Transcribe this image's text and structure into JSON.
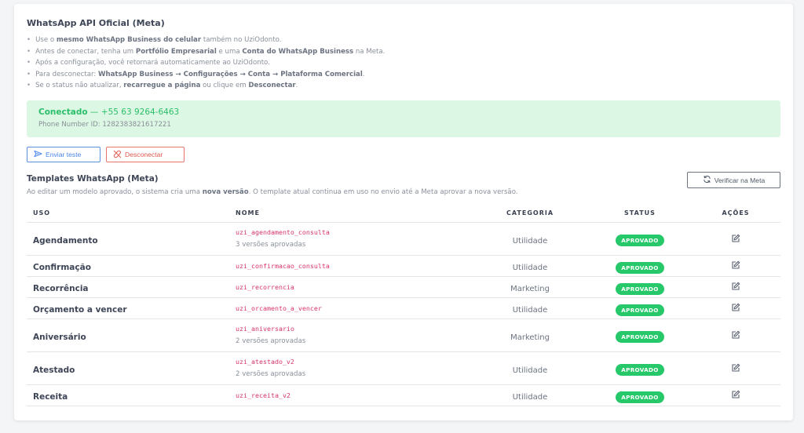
{
  "header": {
    "title": "WhatsApp API Oficial (Meta)",
    "bullets": [
      [
        {
          "t": "Use o "
        },
        {
          "t": "mesmo WhatsApp Business do celular",
          "b": true
        },
        {
          "t": " também no UziOdonto."
        }
      ],
      [
        {
          "t": "Antes de conectar, tenha um "
        },
        {
          "t": "Portfólio Empresarial",
          "b": true
        },
        {
          "t": " e uma "
        },
        {
          "t": "Conta do WhatsApp Business",
          "b": true
        },
        {
          "t": " na Meta."
        }
      ],
      [
        {
          "t": "Após a configuração, você retornará automaticamente ao UziOdonto."
        }
      ],
      [
        {
          "t": "Para desconectar: "
        },
        {
          "t": "WhatsApp Business → Configurações → Conta → Plataforma Comercial",
          "b": true
        },
        {
          "t": "."
        }
      ],
      [
        {
          "t": "Se o status não atualizar, "
        },
        {
          "t": "recarregue a página",
          "b": true
        },
        {
          "t": " ou clique em "
        },
        {
          "t": "Desconectar",
          "b": true
        },
        {
          "t": "."
        }
      ]
    ]
  },
  "connection": {
    "status": "Conectado",
    "separator": " — ",
    "phone": "+55 63 9264-6463",
    "phone_id_line": "Phone Number ID: 1282383821617221",
    "color": "#2bbf6a"
  },
  "actions": {
    "send_test": "Enviar teste",
    "disconnect": "Desconectar",
    "verify": "Verificar na Meta"
  },
  "templates": {
    "title": "Templates WhatsApp (Meta)",
    "desc_before": "Ao editar um modelo aprovado, o sistema cria uma ",
    "desc_bold": "nova versão",
    "desc_after": ". O template atual continua em uso no envio até a Meta aprovar a nova versão.",
    "columns": {
      "uso": "USO",
      "nome": "NOME",
      "categoria": "CATEGORIA",
      "status": "STATUS",
      "acoes": "AÇÕES"
    },
    "rows": [
      {
        "uso": "Agendamento",
        "nome": "uzi_agendamento_consulta",
        "versions": "3 versões aprovadas",
        "categoria": "Utilidade",
        "status": "APROVADO"
      },
      {
        "uso": "Confirmação",
        "nome": "uzi_confirmacao_consulta",
        "versions": "",
        "categoria": "Utilidade",
        "status": "APROVADO"
      },
      {
        "uso": "Recorrência",
        "nome": "uzi_recorrencia",
        "versions": "",
        "categoria": "Marketing",
        "status": "APROVADO"
      },
      {
        "uso": "Orçamento a vencer",
        "nome": "uzi_orcamento_a_vencer",
        "versions": "",
        "categoria": "Utilidade",
        "status": "APROVADO"
      },
      {
        "uso": "Aniversário",
        "nome": "uzi_aniversario",
        "versions": "2 versões aprovadas",
        "categoria": "Marketing",
        "status": "APROVADO"
      },
      {
        "uso": "Atestado",
        "nome": "uzi_atestado_v2",
        "versions": "2 versões aprovadas",
        "categoria": "Utilidade",
        "status": "APROVADO"
      },
      {
        "uso": "Receita",
        "nome": "uzi_receita_v2",
        "versions": "",
        "categoria": "Utilidade",
        "status": "APROVADO"
      }
    ]
  },
  "icons": {
    "send": "send-icon",
    "disconnect": "unlink-icon",
    "verify": "refresh-icon",
    "edit": "edit-icon"
  },
  "colors": {
    "badge": "#26c86a",
    "code": "#d6336c",
    "status_bg": "#dcf7e4",
    "send_btn": "#4a86e8",
    "disconnect_btn": "#e05a50"
  }
}
